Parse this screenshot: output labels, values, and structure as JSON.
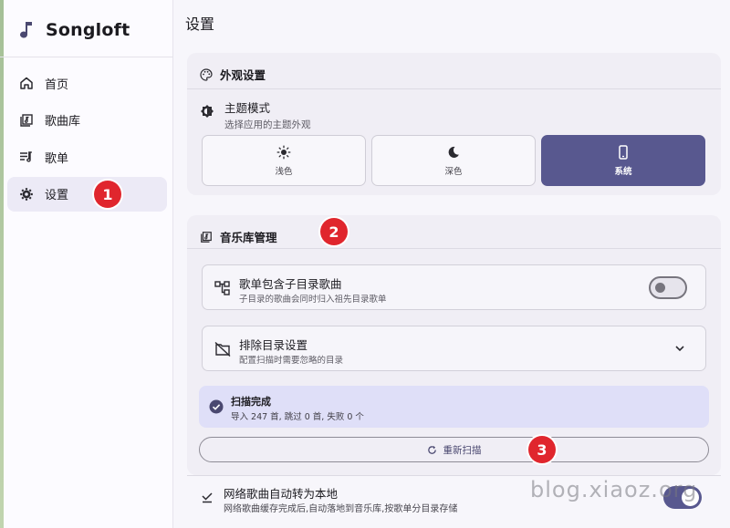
{
  "app": {
    "name": "Songloft"
  },
  "sidebar": {
    "items": [
      {
        "label": "首页",
        "icon": "home-icon",
        "active": false
      },
      {
        "label": "歌曲库",
        "icon": "music-library-icon",
        "active": false
      },
      {
        "label": "歌单",
        "icon": "playlist-icon",
        "active": false
      },
      {
        "label": "设置",
        "icon": "gear-icon",
        "active": true
      }
    ]
  },
  "page": {
    "title": "设置"
  },
  "appearance": {
    "heading": "外观设置",
    "theme_title": "主题模式",
    "theme_desc": "选择应用的主题外观",
    "options": [
      {
        "label": "浅色",
        "icon": "sun-icon",
        "selected": false
      },
      {
        "label": "深色",
        "icon": "moon-icon",
        "selected": false
      },
      {
        "label": "系统",
        "icon": "phone-icon",
        "selected": true
      }
    ]
  },
  "library": {
    "heading": "音乐库管理",
    "subfolder": {
      "title": "歌单包含子目录歌曲",
      "desc": "子目录的歌曲会同时归入祖先目录歌单",
      "enabled": false
    },
    "exclude": {
      "title": "排除目录设置",
      "desc": "配置扫描时需要忽略的目录"
    },
    "scan_status": {
      "title": "扫描完成",
      "desc": "导入 247 首, 跳过 0 首, 失败 0 个"
    },
    "rescan_label": "重新扫描"
  },
  "network": {
    "title": "网络歌曲自动转为本地",
    "desc": "网络歌曲缓存完成后,自动落地到音乐库,按歌单分目录存储",
    "enabled": true
  },
  "annotations": [
    "1",
    "2",
    "3"
  ],
  "watermark": "blog.xiaoz.org",
  "colors": {
    "accent": "#58588f",
    "badge": "#e0262d",
    "status_bg": "#dfdff8"
  }
}
